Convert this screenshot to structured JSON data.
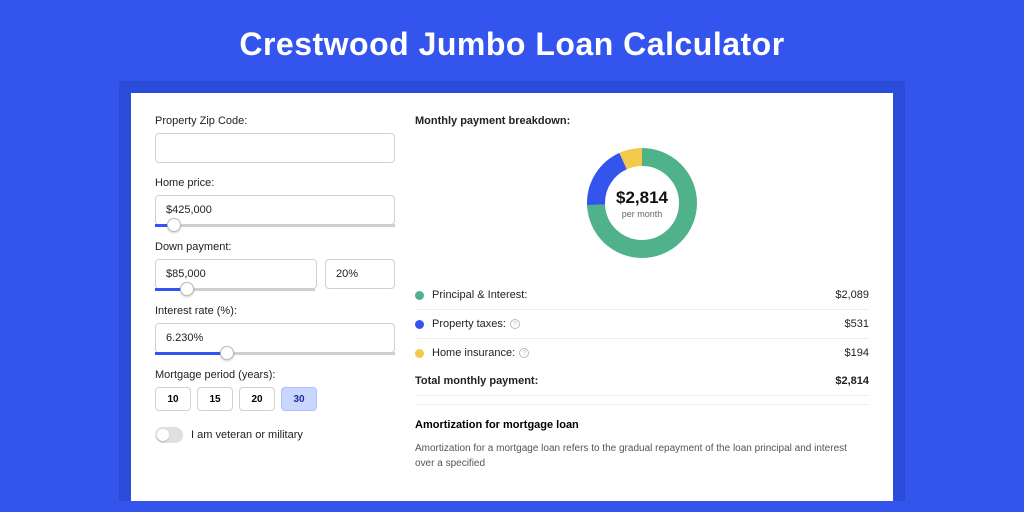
{
  "page_title": "Crestwood Jumbo Loan Calculator",
  "form": {
    "zip_label": "Property Zip Code:",
    "zip_value": "",
    "home_price_label": "Home price:",
    "home_price_value": "$425,000",
    "home_price_slider_pct": 8,
    "down_payment_label": "Down payment:",
    "down_payment_value": "$85,000",
    "down_payment_pct": "20%",
    "down_payment_slider_pct": 20,
    "interest_label": "Interest rate (%):",
    "interest_value": "6.230%",
    "interest_slider_pct": 30,
    "period_label": "Mortgage period (years):",
    "periods": [
      "10",
      "15",
      "20",
      "30"
    ],
    "period_selected": "30",
    "veteran_label": "I am veteran or military",
    "veteran_on": false
  },
  "breakdown": {
    "heading": "Monthly payment breakdown:",
    "donut_value": "$2,814",
    "donut_sub": "per month",
    "items": [
      {
        "label": "Principal & Interest:",
        "value": "$2,089",
        "color": "#4fb28a",
        "info": false
      },
      {
        "label": "Property taxes:",
        "value": "$531",
        "color": "#3355ee",
        "info": true
      },
      {
        "label": "Home insurance:",
        "value": "$194",
        "color": "#f2c94c",
        "info": true
      }
    ],
    "total_label": "Total monthly payment:",
    "total_value": "$2,814"
  },
  "chart_data": {
    "type": "pie",
    "title": "Monthly payment breakdown",
    "series": [
      {
        "name": "Principal & Interest",
        "value": 2089,
        "color": "#4fb28a"
      },
      {
        "name": "Property taxes",
        "value": 531,
        "color": "#3355ee"
      },
      {
        "name": "Home insurance",
        "value": 194,
        "color": "#f2c94c"
      }
    ],
    "total": 2814,
    "center_label": "$2,814",
    "center_sub": "per month"
  },
  "amortization": {
    "heading": "Amortization for mortgage loan",
    "body": "Amortization for a mortgage loan refers to the gradual repayment of the loan principal and interest over a specified"
  }
}
